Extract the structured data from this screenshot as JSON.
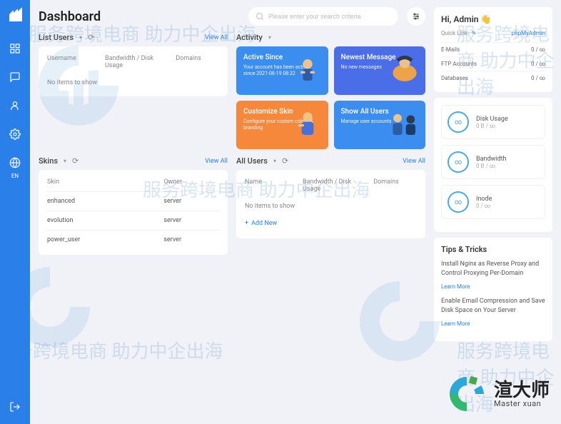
{
  "page": {
    "title": "Dashboard"
  },
  "search": {
    "placeholder": "Please enter your search criteria"
  },
  "sidebar": {
    "lang": "EN"
  },
  "panels": {
    "listUsers": {
      "title": "List Users",
      "viewAll": "View All",
      "cols": [
        "Username",
        "Bandwidth / Disk Usage",
        "Domains"
      ],
      "empty": "No items to show"
    },
    "activity": {
      "title": "Activity",
      "tiles": [
        {
          "title": "Active Since",
          "sub": "Your account has been active since 2021-06-19 08:32"
        },
        {
          "title": "Newest Message",
          "sub": "No new messages"
        },
        {
          "title": "Customize Skin",
          "sub": "Configure your custom colors & branding"
        },
        {
          "title": "Show All Users",
          "sub": "Manage user accounts"
        }
      ]
    },
    "skins": {
      "title": "Skins",
      "viewAll": "View All",
      "cols": [
        "Skin",
        "Owner"
      ],
      "rows": [
        {
          "skin": "enhanced",
          "owner": "server"
        },
        {
          "skin": "evolution",
          "owner": "server"
        },
        {
          "skin": "power_user",
          "owner": "server"
        }
      ]
    },
    "allUsers": {
      "title": "All Users",
      "viewAll": "View All",
      "cols": [
        "Name",
        "Bandwidth / Disk Usage",
        "Domains"
      ],
      "empty": "No items to show",
      "addNew": "Add New"
    }
  },
  "right": {
    "greeting": "Hi, Admin 👋",
    "quickLink": {
      "label": "Quick Link:",
      "value": "phpMyAdmin"
    },
    "stats": [
      {
        "label": "E-Mails",
        "value": "0 / ∞"
      },
      {
        "label": "FTP Accounts",
        "value": "0 / ∞"
      },
      {
        "label": "Databases",
        "value": "0 / ∞"
      }
    ],
    "metrics": [
      {
        "label": "Disk Usage",
        "value": "0 B / ∞"
      },
      {
        "label": "Bandwidth",
        "value": "0 B / ∞"
      },
      {
        "label": "Inode",
        "value": "0 / ∞"
      }
    ],
    "tips": {
      "title": "Tips & Tricks",
      "items": [
        {
          "text": "Install Nginx as Reverse Proxy and Control Proxying Per-Domain",
          "link": "Learn More"
        },
        {
          "text": "Enable Email Compression and Save Disk Space on Your Server",
          "link": "Learn More"
        }
      ]
    }
  },
  "watermarks": {
    "text1": "服务跨境电商 助力中企出海",
    "brand_cn": "渲大师",
    "brand_en": "Master xuan"
  }
}
